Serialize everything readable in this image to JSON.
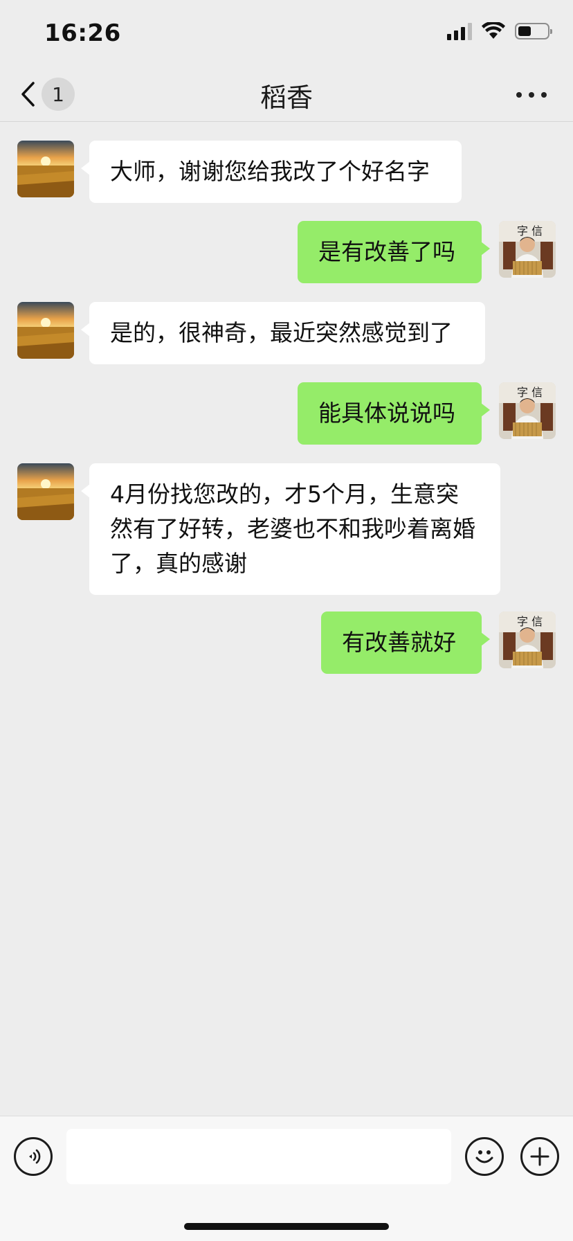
{
  "status_bar": {
    "time": "16:26",
    "battery_level": 0.45
  },
  "nav": {
    "unread_count": "1",
    "title": "稻香"
  },
  "messages": [
    {
      "side": "left",
      "sender": "contact",
      "text": "大师，谢谢您给我改了个好名字"
    },
    {
      "side": "right",
      "sender": "me",
      "text": "是有改善了吗"
    },
    {
      "side": "left",
      "sender": "contact",
      "text": "是的，很神奇，最近突然感觉到了"
    },
    {
      "side": "right",
      "sender": "me",
      "text": "能具体说说吗"
    },
    {
      "side": "left",
      "sender": "contact",
      "text": "4月份找您改的，才5个月，生意突然有了好转，老婆也不和我吵着离婚了，真的感谢"
    },
    {
      "side": "right",
      "sender": "me",
      "text": "有改善就好"
    }
  ],
  "input_bar": {
    "value": ""
  },
  "colors": {
    "background": "#ededed",
    "bubble_self": "#95ec69",
    "bubble_other": "#ffffff"
  },
  "icons": [
    "back-chevron-icon",
    "more-icon",
    "voice-icon",
    "emoji-icon",
    "plus-icon",
    "wheat-field-avatar",
    "person-avatar"
  ]
}
